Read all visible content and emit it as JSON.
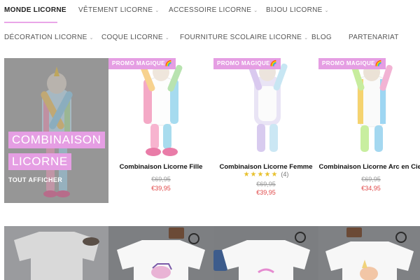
{
  "nav": {
    "row1": [
      {
        "label": "MONDE LICORNE",
        "active": true,
        "dropdown": false
      },
      {
        "label": "VÊTEMENT LICORNE",
        "active": false,
        "dropdown": true
      },
      {
        "label": "ACCESSOIRE LICORNE",
        "active": false,
        "dropdown": true
      },
      {
        "label": "BIJOU LICORNE",
        "active": false,
        "dropdown": true
      }
    ],
    "row2": [
      {
        "label": "DÉCORATION LICORNE",
        "dropdown": true
      },
      {
        "label": "COQUE LICORNE",
        "dropdown": true
      },
      {
        "label": "FOURNITURE SCOLAIRE LICORNE",
        "dropdown": true
      },
      {
        "label": "BLOG",
        "dropdown": false
      },
      {
        "label": "PARTENARIAT",
        "dropdown": false
      }
    ],
    "chevron_icon": "chevron-down-icon"
  },
  "hero": {
    "title_line1": "COMBINAISON",
    "title_line2": "LICORNE",
    "link": "TOUT AFFICHER"
  },
  "products": [
    {
      "badge": "PROMO MAGIQUE🌈",
      "name": "Combinaison Licorne Fille",
      "old_price": "€69,95",
      "price": "€39,95"
    },
    {
      "badge": "PROMO MAGIQUE🌈",
      "name": "Combinaison Licorne Femme",
      "stars": "★★★★★",
      "rating": 4.5,
      "review_count": "(4)",
      "old_price": "€69,95",
      "price": "€39,95"
    },
    {
      "badge": "PROMO MAGIQUE🌈",
      "name": "Combinaison Licorne Arc en Ciel",
      "old_price": "€69,95",
      "price": "€34,95"
    }
  ],
  "colors": {
    "accent_pink": "#e59ee3",
    "sale_red": "#e04848",
    "star_yellow": "#e8c12f"
  }
}
